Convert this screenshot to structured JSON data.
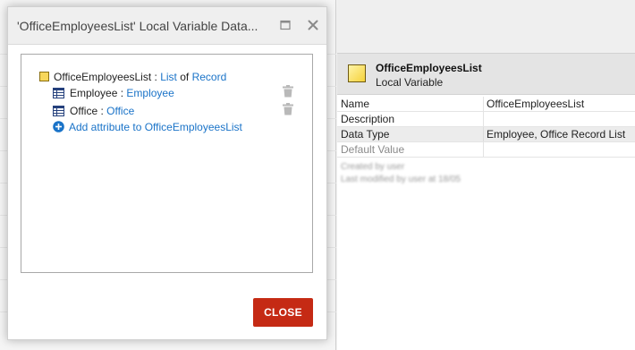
{
  "dialog": {
    "title": "'OfficeEmployeesList' Local Variable Data...",
    "close_button_label": "CLOSE",
    "tree": {
      "root": {
        "name": "OfficeEmployeesList",
        "sep": " : ",
        "list_label": "List",
        "of_label": " of ",
        "type_label": "Record"
      },
      "attributes": [
        {
          "name": "Employee",
          "sep": " : ",
          "type": "Employee"
        },
        {
          "name": "Office",
          "sep": " : ",
          "type": "Office"
        }
      ],
      "add_attribute_label": "Add attribute to OfficeEmployeesList"
    }
  },
  "properties": {
    "title": "OfficeEmployeesList",
    "subtitle": "Local Variable",
    "rows": [
      {
        "key": "Name",
        "value": "OfficeEmployeesList"
      },
      {
        "key": "Description",
        "value": ""
      },
      {
        "key": "Data Type",
        "value": "Employee, Office Record List"
      },
      {
        "key": "Default Value",
        "value": ""
      }
    ],
    "meta_line1": "Created by user",
    "meta_line2": "Last modified by user at 18/05"
  },
  "colors": {
    "accent_link": "#1a73c8",
    "close_button": "#c52a14",
    "variable_icon": "#f5d23a"
  },
  "icons": {
    "record": "record-variable-icon",
    "entity": "entity-grid-icon",
    "add": "plus-circle-icon",
    "trash": "trash-icon",
    "maximize": "maximize-icon",
    "close": "close-icon"
  }
}
